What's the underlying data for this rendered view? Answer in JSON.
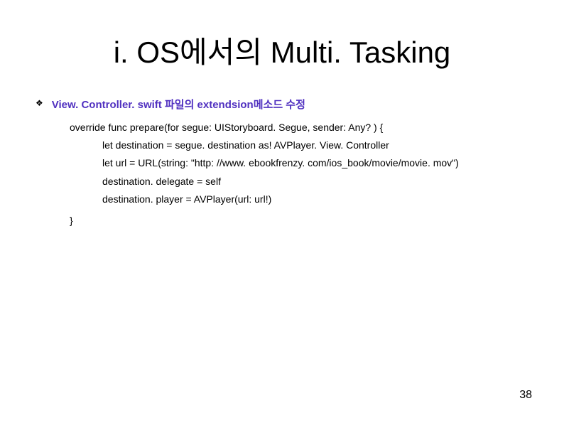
{
  "title": "i. OS에서의 Multi. Tasking",
  "bullet": {
    "text": "View. Controller. swift 파일의 extendsion메소드 수정"
  },
  "code": {
    "line1": "override func prepare(for segue: UIStoryboard. Segue, sender: Any? ) {",
    "line2": "let destination = segue. destination as! AVPlayer. View. Controller",
    "line3": "let url = URL(string: \"http: //www. ebookfrenzy. com/ios_book/movie/movie. mov\")",
    "line4": "destination. delegate = self",
    "line5": "destination. player = AVPlayer(url: url!)",
    "close": "}"
  },
  "pageNumber": "38"
}
